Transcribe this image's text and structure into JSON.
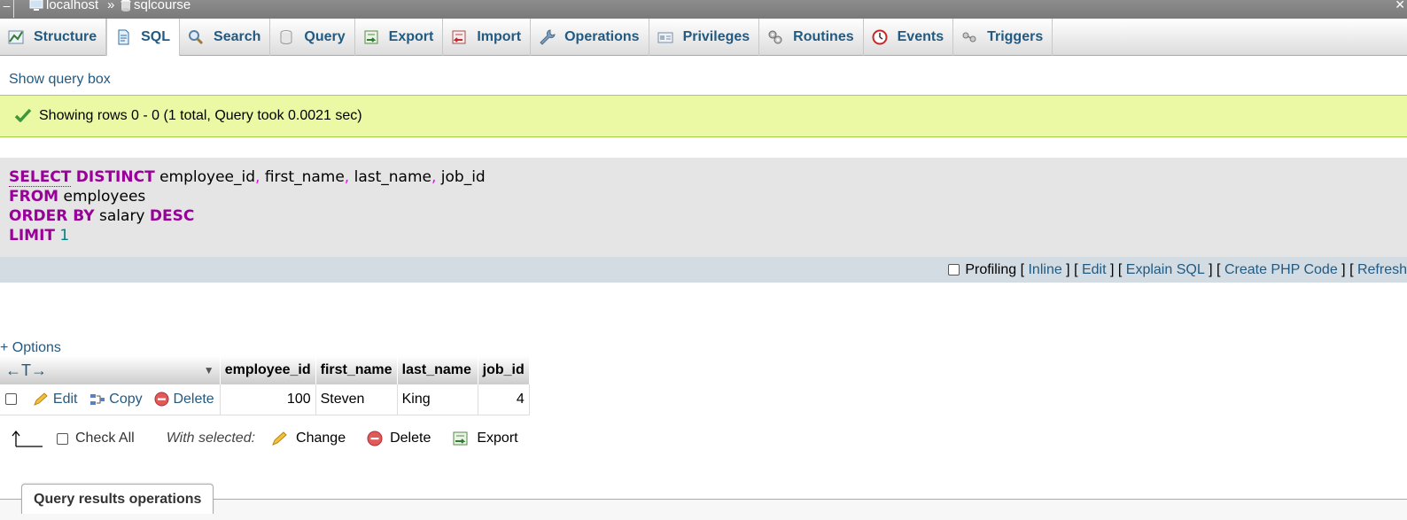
{
  "breadcrumb": {
    "server": "localhost",
    "separator": "»",
    "database": "sqlcourse"
  },
  "tabs": [
    {
      "label": "Structure",
      "icon": "structure-icon"
    },
    {
      "label": "SQL",
      "icon": "sql-icon",
      "active": true
    },
    {
      "label": "Search",
      "icon": "search-icon"
    },
    {
      "label": "Query",
      "icon": "query-icon"
    },
    {
      "label": "Export",
      "icon": "export-icon"
    },
    {
      "label": "Import",
      "icon": "import-icon"
    },
    {
      "label": "Operations",
      "icon": "wrench-icon"
    },
    {
      "label": "Privileges",
      "icon": "privileges-icon"
    },
    {
      "label": "Routines",
      "icon": "routines-icon"
    },
    {
      "label": "Events",
      "icon": "events-icon"
    },
    {
      "label": "Triggers",
      "icon": "triggers-icon"
    }
  ],
  "show_query_box": "Show query box",
  "message": "Showing rows 0 - 0 (1 total, Query took 0.0021 sec)",
  "sql": {
    "line1": {
      "kw1": "SELECT",
      "kw2": "DISTINCT",
      "c1": "employee_id",
      "c2": "first_name",
      "c3": "last_name",
      "c4": "job_id",
      "comma": ","
    },
    "line2": {
      "kw": "FROM",
      "table": "employees"
    },
    "line3": {
      "kw": "ORDER BY",
      "col": "salary",
      "dir": "DESC"
    },
    "line4": {
      "kw": "LIMIT",
      "n": "1"
    }
  },
  "sql_footer": {
    "profiling": "Profiling",
    "inline": "Inline",
    "edit": "Edit",
    "explain": "Explain SQL",
    "php": "Create PHP Code",
    "refresh": "Refresh"
  },
  "options_link": "+ Options",
  "table": {
    "columns": [
      "employee_id",
      "first_name",
      "last_name",
      "job_id"
    ],
    "rows": [
      {
        "employee_id": "100",
        "first_name": "Steven",
        "last_name": "King",
        "job_id": "4"
      }
    ],
    "row_actions": {
      "edit": "Edit",
      "copy": "Copy",
      "delete": "Delete"
    },
    "sort_arrows": "←T→"
  },
  "bulk": {
    "check_all": "Check All",
    "with_selected": "With selected:",
    "change": "Change",
    "delete": "Delete",
    "export": "Export"
  },
  "query_results_operations": "Query results operations",
  "colors": {
    "link": "#235a81",
    "keyword": "#990099",
    "success_bg": "#ebf8a4",
    "sql_bg": "#e5e5e5",
    "footer_bg": "#d3dce3"
  }
}
